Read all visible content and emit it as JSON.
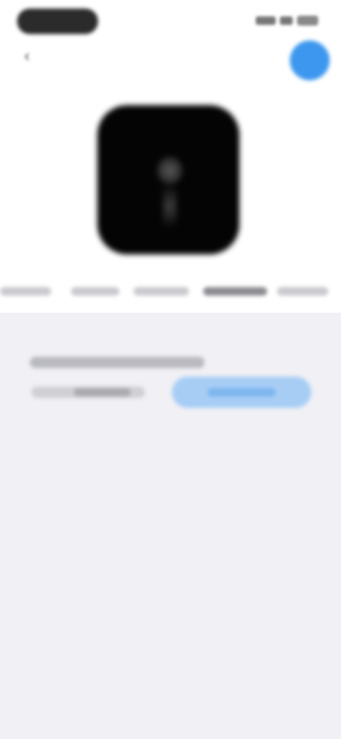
{
  "status_bar": {
    "time": "",
    "signal_icon": "signal-icon",
    "wifi_icon": "wifi-icon",
    "battery_icon": "battery-icon"
  },
  "header": {
    "back_icon": "chevron-left-icon",
    "nav_link": "",
    "action_color": "#3d97ee"
  },
  "hero": {
    "icon_color": "#040404"
  },
  "tabs": [
    {
      "label": ""
    },
    {
      "label": ""
    },
    {
      "label": ""
    },
    {
      "label": "",
      "active": true
    },
    {
      "label": ""
    }
  ],
  "content": {
    "row_label": "",
    "field_value": "",
    "button_label": "",
    "button_color": "#a7cdf5"
  },
  "colors": {
    "background": "#f0f0f5",
    "top_area": "#ffffff",
    "accent": "#4a9fee"
  }
}
